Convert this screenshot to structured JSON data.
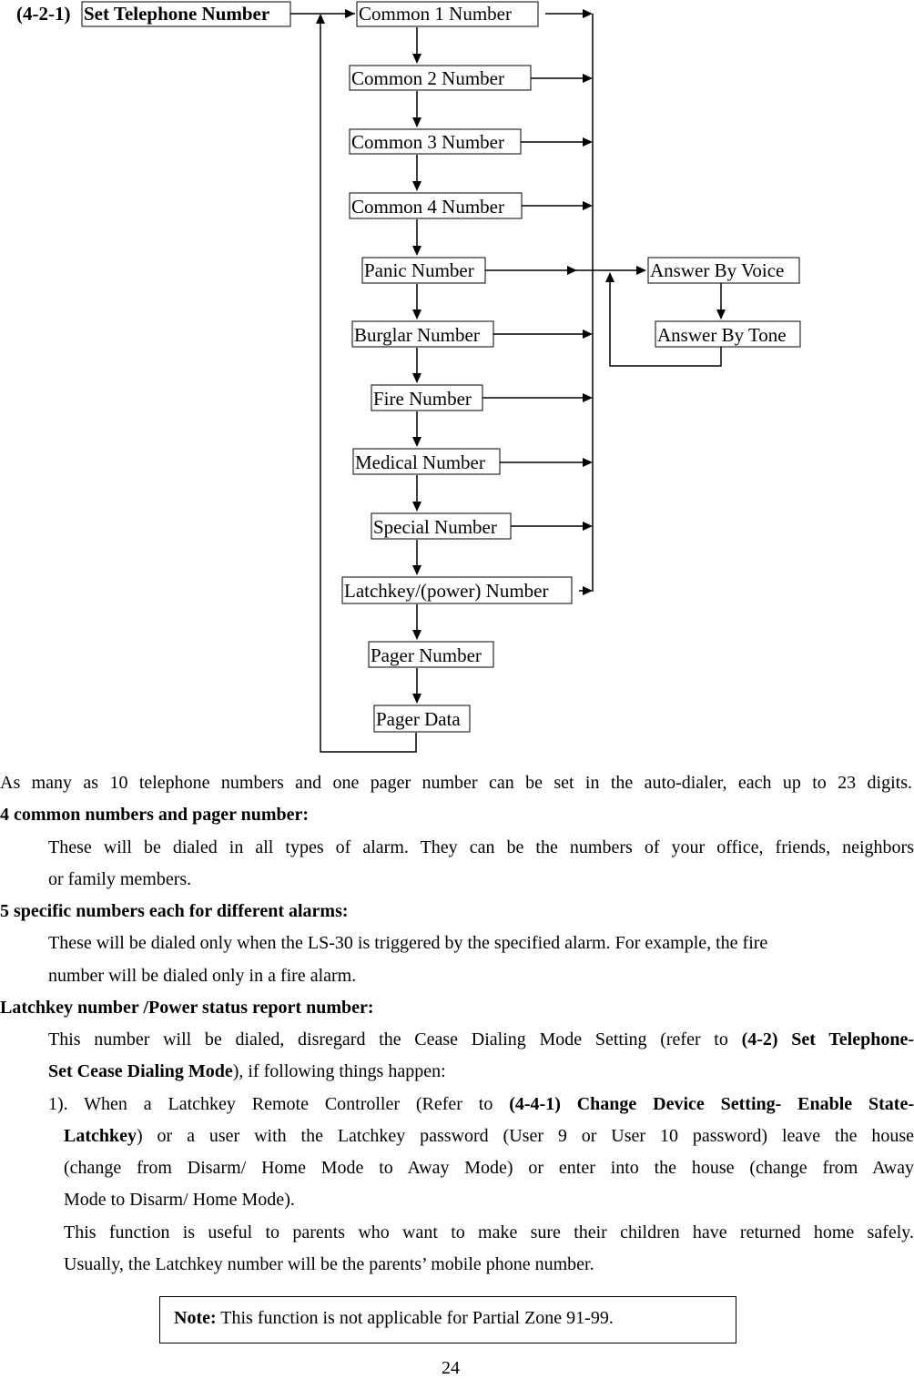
{
  "diagram": {
    "section_number": "(4-2-1)",
    "root": "Set Telephone Number",
    "nodes": [
      "Common 1 Number",
      "Common 2 Number",
      "Common 3 Number",
      "Common 4 Number",
      "Panic Number",
      "Burglar Number",
      "Fire Number",
      "Medical Number",
      "Special Number",
      "Latchkey/(power) Number",
      "Pager Number",
      "Pager Data"
    ],
    "answer_nodes": [
      "Answer By Voice",
      "Answer By Tone"
    ]
  },
  "body": {
    "intro": "As many as 10 telephone numbers and one pager number can be set in the auto-dialer, each up to 23 digits.",
    "sections": [
      {
        "heading": "4 common numbers and pager number:",
        "lines": [
          "These will be dialed in all types of alarm. They can be the numbers of your office, friends, neighbors",
          "or family members."
        ]
      },
      {
        "heading": "5 specific numbers each for different alarms:",
        "lines": [
          "These will be dialed only when the LS-30 is triggered by the specified alarm. For example, the fire",
          "number will be dialed only in a fire alarm."
        ]
      },
      {
        "heading": "Latchkey number /Power status report number:",
        "line1_pre": "This number will be dialed, disregard the Cease Dialing Mode Setting (refer to ",
        "line1_bold": "(4-2) Set Telephone-",
        "line2_bold": "Set Cease Dialing Mode",
        "line2_post": "), if following things happen:",
        "item1_pre": "1). When a Latchkey Remote Controller (Refer to ",
        "item1_bold": "(4-4-1) Change Device Setting- Enable State-",
        "item2_bold": "Latchkey",
        "item2_post": ") or a user with the Latchkey password (User 9 or User 10 password) leave the house",
        "item3": "(change from Disarm/ Home Mode to Away Mode) or enter into the house (change from Away",
        "item4": "Mode to Disarm/ Home Mode).",
        "item5": "This function is useful to parents who want to make sure their children have returned home safely.",
        "item6": "Usually, the Latchkey number will be the parents’ mobile phone number."
      }
    ]
  },
  "note": {
    "label": "Note:",
    "text": " This function is not applicable for Partial Zone 91-99."
  },
  "page_number": "24"
}
